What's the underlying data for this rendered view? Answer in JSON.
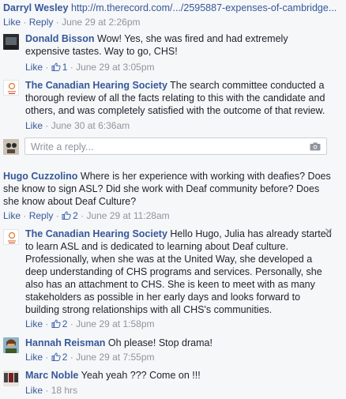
{
  "comments": [
    {
      "author": "Darryl Wesley",
      "text": "http://m.therecord.com/.../2595887-expenses-of-cambridge...",
      "like": "Like",
      "reply": "Reply",
      "time": "June 29 at 2:26pm"
    },
    {
      "author": "Donald Bisson",
      "text_line1": "Wow! Yes, she was fired and had extremely",
      "text_line2": "expensive tastes. Way to go, CHS!",
      "like": "Like",
      "likes": "1",
      "time": "June 29 at 3:05pm"
    },
    {
      "author": "The Canadian Hearing Society",
      "text_line1": "The search committee conducted a",
      "text_line2": "thorough review of all the facts relating to this with the candidate and",
      "text_line3": "others, and was completely satisfied with the outcome of that review.",
      "like": "Like",
      "time": "June 30 at 6:36am"
    },
    {
      "author": "Hugo Cuzzolino",
      "text_line1": "Where is her experience with working with deafies? Does",
      "text_line2": "she know to sign ASL? Did she work with Deaf community before? Does",
      "text_line3": "she know about Deaf Culture?",
      "like": "Like",
      "reply": "Reply",
      "likes": "2",
      "time": "June 29 at 11:28am"
    },
    {
      "author": "The Canadian Hearing Society",
      "text_line1": "Hello Hugo, Julia has already started",
      "text_line2": "to learn ASL and is dedicated to learning about Deaf culture.",
      "text_line3": "Professionally, when she was at the United Way, she developed a",
      "text_line4": "deep understanding of CHS programs and services. Personally, she",
      "text_line5": "also has an attachment to CHS. She is keen to meet with as many",
      "text_line6": "stakeholders as possible in her early days and looks forward to",
      "text_line7": "building strong relationships with all CHS's communities.",
      "like": "Like",
      "likes": "2",
      "time": "June 29 at 1:58pm"
    },
    {
      "author": "Hannah Reisman",
      "text": "Oh please! Stop drama!",
      "like": "Like",
      "likes": "2",
      "time": "June 29 at 7:55pm"
    },
    {
      "author": "Marc Noble",
      "text": "Yeah yeah ??? Come on !!!",
      "like": "Like",
      "time": "18 hrs"
    }
  ],
  "reply_box": {
    "placeholder": "Write a reply..."
  },
  "separator": "·",
  "icons": [
    "like-icon",
    "camera-icon",
    "close-icon"
  ],
  "colors": {
    "link": "#365899",
    "meta": "#90949c",
    "text": "#1d2129",
    "background": "#f6f7f9"
  }
}
